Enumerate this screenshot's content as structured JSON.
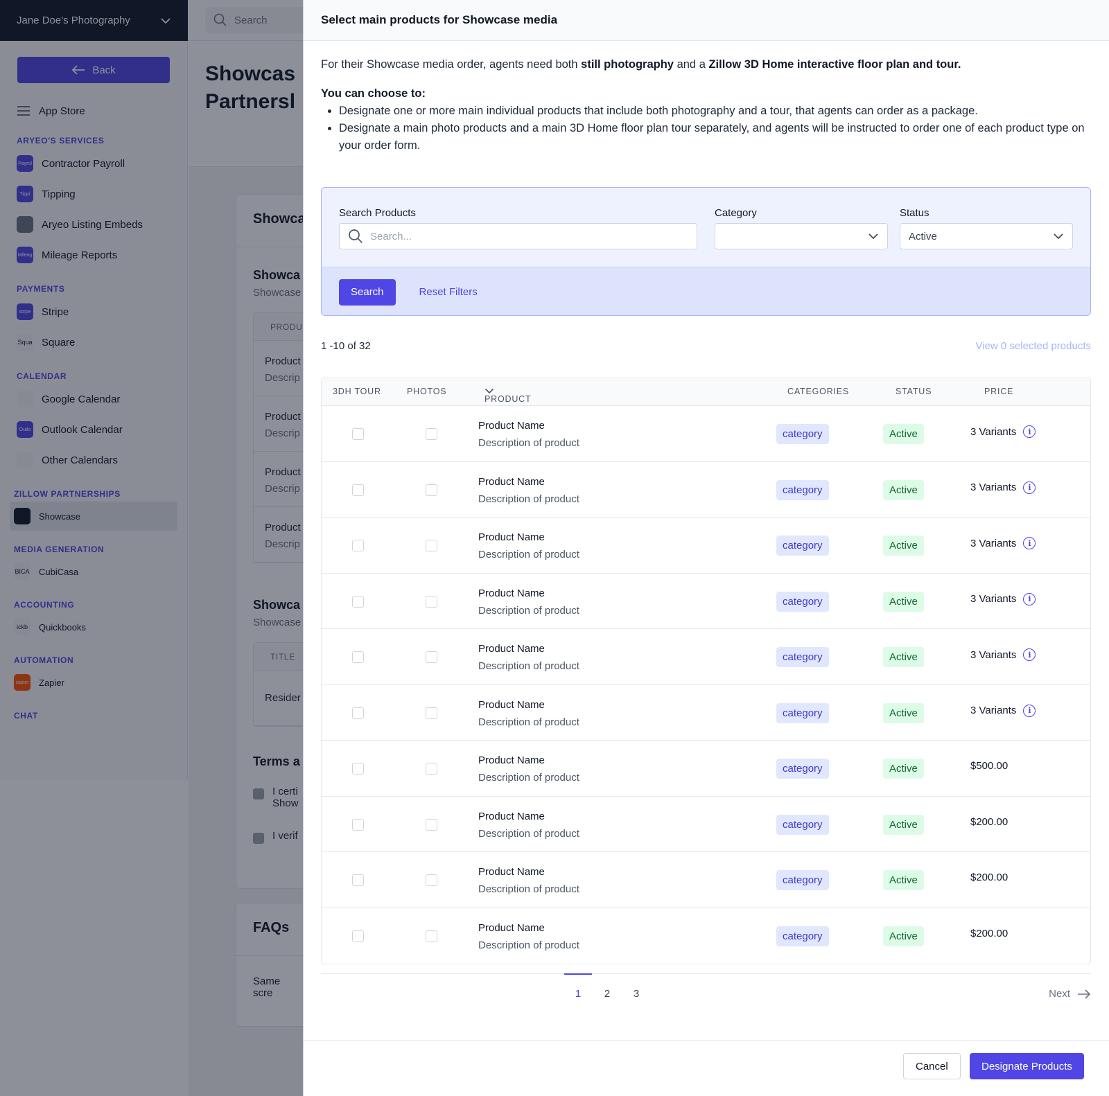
{
  "account": {
    "name": "Jane Doe's Photography"
  },
  "top_search": {
    "placeholder": "Search"
  },
  "sidebar": {
    "back_label": "Back",
    "app_store_label": "App Store",
    "sections": [
      {
        "title": "ARYEO'S SERVICES",
        "items": [
          {
            "label": "Contractor Payroll",
            "logo_text": "Payrol"
          },
          {
            "label": "Tipping",
            "logo_text": "Tippi"
          },
          {
            "label": "Aryeo Listing Embeds",
            "logo_text": ""
          },
          {
            "label": "Mileage Reports",
            "logo_text": "Mileag"
          }
        ]
      },
      {
        "title": "PAYMENTS",
        "items": [
          {
            "label": "Stripe",
            "logo_text": "stripe"
          },
          {
            "label": "Square",
            "logo_text": "Squa"
          }
        ]
      },
      {
        "title": "CALENDAR",
        "items": [
          {
            "label": "Google Calendar",
            "logo_text": ""
          },
          {
            "label": "Outlook Calendar",
            "logo_text": "Outlo"
          },
          {
            "label": "Other Calendars",
            "logo_text": ""
          }
        ]
      },
      {
        "title": "ZILLOW PARTNERSHIPS",
        "items": [
          {
            "label": "Showcase",
            "logo_text": ""
          }
        ]
      },
      {
        "title": "MEDIA GENERATION",
        "items": [
          {
            "label": "CubiCasa",
            "logo_text": "BICA"
          }
        ]
      },
      {
        "title": "ACCOUNTING",
        "items": [
          {
            "label": "Quickbooks",
            "logo_text": "ickb"
          }
        ]
      },
      {
        "title": "AUTOMATION",
        "items": [
          {
            "label": "Zapier",
            "logo_text": "zapier"
          }
        ]
      },
      {
        "title": "CHAT",
        "items": []
      }
    ]
  },
  "background_page": {
    "title_line1": "Showcas",
    "title_line2": "Partnersl",
    "card1": {
      "heading": "Showca",
      "sub1": "Showca",
      "sub1_text": "Showcase",
      "table_header": "PRODU",
      "rows": [
        {
          "name": "Product",
          "desc": "Descrip"
        },
        {
          "name": "Product",
          "desc": "Descrip"
        },
        {
          "name": "Product",
          "desc": "Descrip"
        },
        {
          "name": "Product",
          "desc": "Descrip"
        }
      ],
      "sub2": "Showca",
      "sub2_text": "Showcase",
      "table2_header": "TITLE",
      "table2_row": "Resider",
      "terms_heading": "Terms a",
      "check1_line1": "I certi",
      "check1_line2": "Show",
      "check2": "I verif"
    },
    "card2": {
      "heading": "FAQs",
      "text": "Same scre"
    }
  },
  "modal": {
    "title": "Select main products for Showcase media",
    "intro_pre": "For their Showcase media order, agents need both ",
    "intro_bold1": "still photography",
    "intro_mid": " and a ",
    "intro_bold2": "Zillow 3D Home interactive floor plan and tour.",
    "choose_heading": "You can choose to:",
    "bullet1": "Designate one or more main individual products that include both photography and a tour, that agents can order as a package.",
    "bullet2": "Designate a main photo products and a main 3D Home floor plan tour separately, and agents will be instructed to order one of each product type on your order form.",
    "filters": {
      "search_label": "Search Products",
      "search_placeholder": "Search...",
      "category_label": "Category",
      "category_value": "",
      "status_label": "Status",
      "status_value": "Active",
      "search_button": "Search",
      "reset_link": "Reset Filters"
    },
    "results_count": "1 -10 of 32",
    "view_selected": "View 0 selected products",
    "columns": {
      "tour": "3DH TOUR",
      "photos": "PHOTOS",
      "product": "PRODUCT",
      "categories": "CATEGORIES",
      "status": "STATUS",
      "price": "PRICE"
    },
    "rows": [
      {
        "name": "Product Name",
        "desc": "Description of product",
        "category": "category",
        "status": "Active",
        "price": "3 Variants",
        "info": true
      },
      {
        "name": "Product Name",
        "desc": "Description of product",
        "category": "category",
        "status": "Active",
        "price": "3 Variants",
        "info": true
      },
      {
        "name": "Product Name",
        "desc": "Description of product",
        "category": "category",
        "status": "Active",
        "price": "3 Variants",
        "info": true
      },
      {
        "name": "Product Name",
        "desc": "Description of product",
        "category": "category",
        "status": "Active",
        "price": "3 Variants",
        "info": true
      },
      {
        "name": "Product Name",
        "desc": "Description of product",
        "category": "category",
        "status": "Active",
        "price": "3 Variants",
        "info": true
      },
      {
        "name": "Product Name",
        "desc": "Description of product",
        "category": "category",
        "status": "Active",
        "price": "3 Variants",
        "info": true
      },
      {
        "name": "Product Name",
        "desc": "Description of product",
        "category": "category",
        "status": "Active",
        "price": "$500.00",
        "info": false
      },
      {
        "name": "Product Name",
        "desc": "Description of product",
        "category": "category",
        "status": "Active",
        "price": "$200.00",
        "info": false
      },
      {
        "name": "Product Name",
        "desc": "Description of product",
        "category": "category",
        "status": "Active",
        "price": "$200.00",
        "info": false
      },
      {
        "name": "Product Name",
        "desc": "Description of product",
        "category": "category",
        "status": "Active",
        "price": "$200.00",
        "info": false
      }
    ],
    "pagination": {
      "pages": [
        "1",
        "2",
        "3"
      ],
      "current": "1",
      "next_label": "Next"
    },
    "footer": {
      "cancel_label": "Cancel",
      "designate_label": "Designate Products"
    }
  },
  "colors": {
    "accent": "#4f46e5",
    "dark": "#111827",
    "status_bg": "#dcfce7",
    "category_bg": "#e0e7ff"
  }
}
